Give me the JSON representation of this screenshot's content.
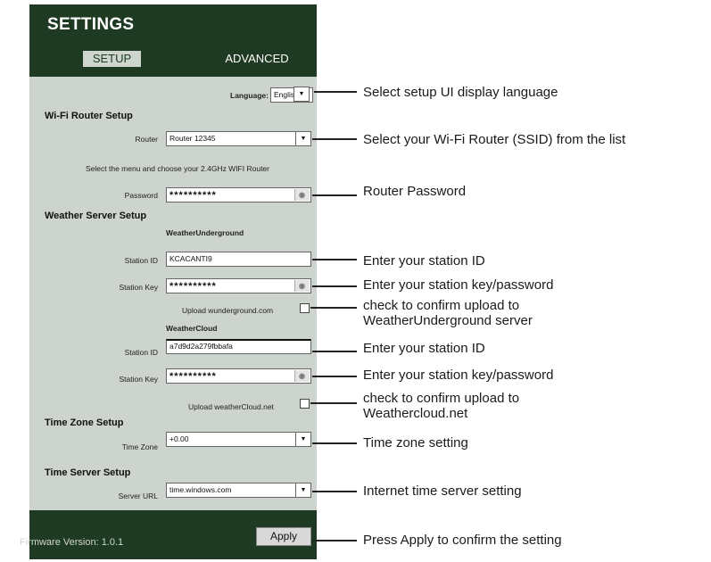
{
  "header": {
    "title": "SETTINGS",
    "tabs": [
      "SETUP",
      "ADVANCED"
    ]
  },
  "language": {
    "label": "Language:",
    "value": "English"
  },
  "wifi": {
    "heading": "Wi-Fi Router Setup",
    "router_label": "Router",
    "router_value": "Router 12345",
    "hint": "Select the menu and choose your 2.4GHz WIFI Router",
    "password_label": "Password",
    "password_value": "**********"
  },
  "weather": {
    "heading": "Weather Server Setup",
    "wu": {
      "name": "WeatherUnderground",
      "station_id_label": "Station ID",
      "station_id_value": "KCACANTI9",
      "station_key_label": "Station Key",
      "station_key_value": "**********",
      "upload_label": "Upload wunderground.com"
    },
    "wc": {
      "name": "WeatherCloud",
      "station_id_label": "Station ID",
      "station_id_value": "a7d9d2a279fbbafa",
      "station_key_label": "Station Key",
      "station_key_value": "**********",
      "upload_label": "Upload weatherCloud.net"
    }
  },
  "timezone": {
    "heading": "Time Zone Setup",
    "label": "Time Zone",
    "value": "+0.00"
  },
  "timeserver": {
    "heading": "Time Server Setup",
    "label": "Server URL",
    "value": "time.windows.com"
  },
  "footer": {
    "firmware": "Firmware Version: 1.0.1",
    "apply": "Apply"
  },
  "annotations": {
    "language": "Select setup UI display language",
    "router": "Select your Wi-Fi Router (SSID) from the list",
    "password": "Router Password",
    "wu_station_id": "Enter your station ID",
    "wu_station_key": "Enter your station key/password",
    "wu_upload": "check to confirm upload to\nWeatherUnderground server",
    "wc_station_id": "Enter your station ID",
    "wc_station_key": "Enter your station key/password",
    "wc_upload": "check to confirm upload to\nWeathercloud.net",
    "timezone": "Time zone setting",
    "timeserver": "Internet time server setting",
    "apply": "Press Apply to confirm the setting"
  },
  "icons": {
    "dropdown": "dropdown-arrow-icon",
    "eye": "eye-icon",
    "checkbox": "checkbox"
  }
}
